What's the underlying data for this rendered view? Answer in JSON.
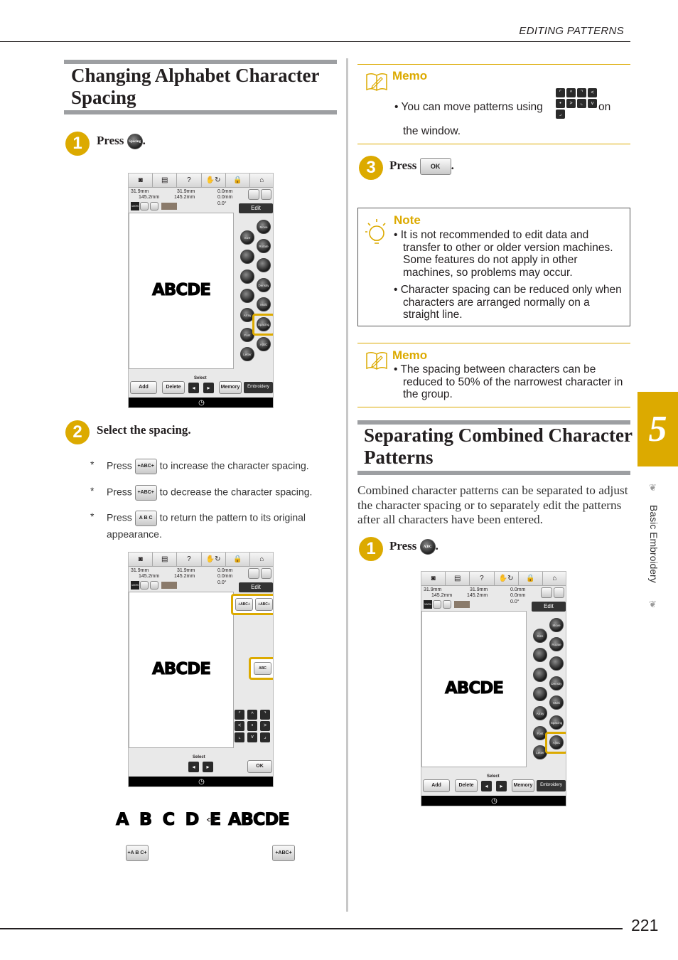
{
  "header": {
    "section": "EDITING PATTERNS"
  },
  "left": {
    "title_line1": "Changing Alphabet Character",
    "title_line2": "Spacing",
    "step1": {
      "num": "1",
      "text": "Press",
      "button": "Spacing"
    },
    "step2": {
      "num": "2",
      "text": "Select the spacing."
    },
    "bullets": [
      {
        "mark": "*",
        "pre": "Press",
        "button": "+ABC+",
        "post": "to increase the character spacing."
      },
      {
        "mark": "*",
        "pre": "Press",
        "button": "+ABC+",
        "post": "to decrease the character spacing."
      },
      {
        "mark": "*",
        "pre": "Press",
        "button": "A B C",
        "post": "to return the pattern to its original",
        "post2": "appearance."
      }
    ],
    "comparison": {
      "spaced": "A B C D E",
      "arrow": "⇔",
      "tight": "ABCDE",
      "btn_left": "+A B C+",
      "btn_right": "+ABC+"
    }
  },
  "right": {
    "memo1": {
      "title": "Memo",
      "text_pre": "You can move patterns using",
      "text_post": "on",
      "text_line2": "the window."
    },
    "step3": {
      "num": "3",
      "text": "Press",
      "button": "OK"
    },
    "note": {
      "title": "Note",
      "items": [
        "It is not recommended to edit data and transfer to other or older version machines. Some features do not apply in other machines, so problems may occur.",
        "Character spacing can be reduced only when characters are arranged normally on a straight line."
      ]
    },
    "memo2": {
      "title": "Memo",
      "text": "The spacing between characters can be reduced to 50% of the narrowest character in the group."
    },
    "title_line1": "Separating Combined Character",
    "title_line2": "Patterns",
    "paragraph": "Combined character patterns can be separated to adjust the character spacing or to separately edit the patterns after all characters have been entered.",
    "step1": {
      "num": "1",
      "text": "Press",
      "button": "A|BC"
    }
  },
  "screen": {
    "toolbar_icons": [
      "camera-icon",
      "page-icon",
      "help-icon",
      "thread-icon",
      "lock-icon",
      "home-icon"
    ],
    "toolbar_glyphs": [
      "◙",
      "▤",
      "?",
      "✋↻",
      "🔒",
      "⌂"
    ],
    "width1": "31.9mm",
    "height1": "145.2mm",
    "width2": "31.9mm",
    "height2": "145.2mm",
    "offset_v": "0.0mm",
    "offset_h": "0.0mm",
    "angle": "0.0°",
    "zoom": "100%",
    "edit_tab": "Edit",
    "pattern": "ABCDE",
    "buttons_left": [
      "Size",
      "",
      "",
      "",
      "Array",
      "Font Type",
      "Letter Size"
    ],
    "buttons_right": [
      "Move",
      "Rotate",
      "",
      "Density",
      "Multi Color",
      "Spacing",
      "A|BC"
    ],
    "add": "Add",
    "delete": "Delete",
    "select": "Select",
    "memory": "Memory",
    "embroidery": "Embroidery",
    "ok": "OK",
    "spacing_wide": "+ABC+",
    "spacing_narrow": "+ABC+",
    "spacing_reset": "ABC"
  },
  "arrow_glyphs": [
    "⌜",
    "^",
    "⌝",
    "<",
    "•",
    ">",
    "⌞",
    "v",
    "⌟"
  ],
  "tab": {
    "chapter": "5",
    "label": "Basic Embroidery"
  },
  "page_number": "221",
  "colors": {
    "accent": "#dcaa00",
    "gray_bar": "#9d9fa2"
  }
}
